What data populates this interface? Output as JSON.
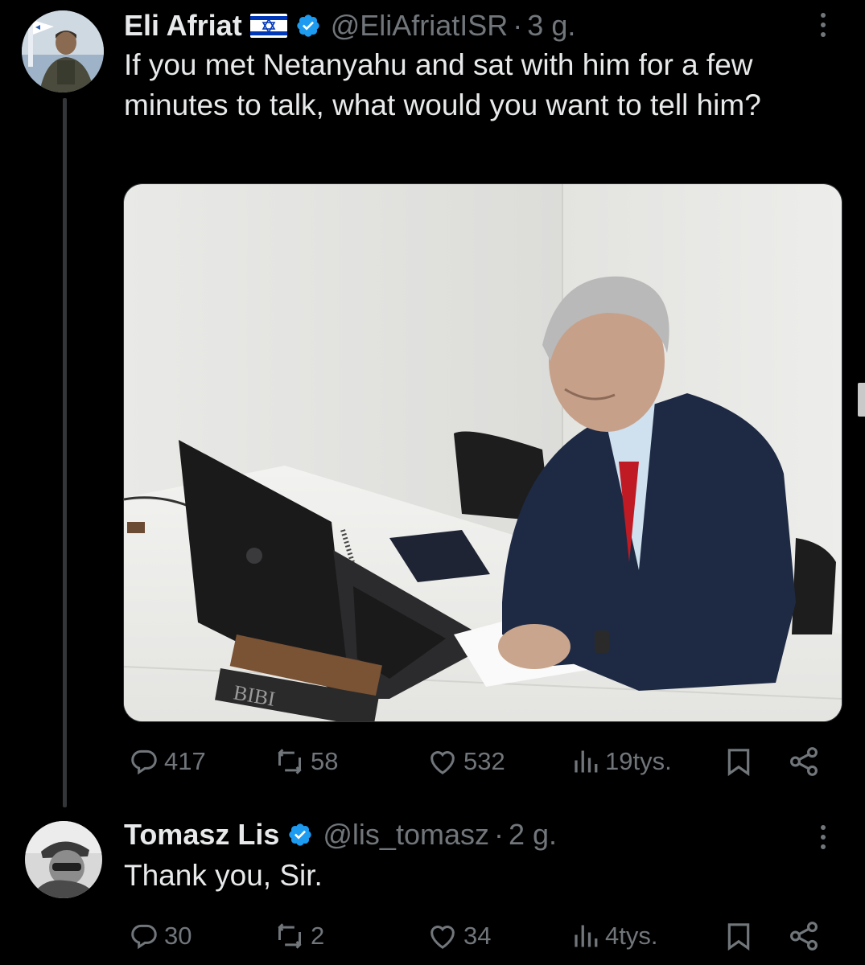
{
  "colors": {
    "background": "#000000",
    "text_primary": "#e7e9ea",
    "text_secondary": "#71767b",
    "verified_blue": "#1d9bf0",
    "thread_line": "#333639"
  },
  "tweet1": {
    "author_name": "Eli Afriat",
    "flag": "israel-flag",
    "handle": "@EliAfriatISR",
    "separator": "·",
    "time": "3 g.",
    "text": "If you met Netanyahu and sat with him for a few minutes to talk, what would you want to tell him?",
    "media": "photo-man-writing-at-desk-with-laptop",
    "book_lettering": "BIBI",
    "actions": {
      "replies": "417",
      "reposts": "58",
      "likes": "532",
      "views": "19tys."
    }
  },
  "tweet2": {
    "author_name": "Tomasz Lis",
    "handle": "@lis_tomasz",
    "separator": "·",
    "time": "2 g.",
    "text": "Thank you, Sir.",
    "actions": {
      "replies": "30",
      "reposts": "2",
      "likes": "34",
      "views": "4tys."
    }
  },
  "icons": {
    "reply": "reply-icon",
    "repost": "repost-icon",
    "like": "heart-icon",
    "views": "views-icon",
    "bookmark": "bookmark-icon",
    "share": "share-icon",
    "more": "more-vertical-icon",
    "verified": "verified-badge-icon"
  }
}
